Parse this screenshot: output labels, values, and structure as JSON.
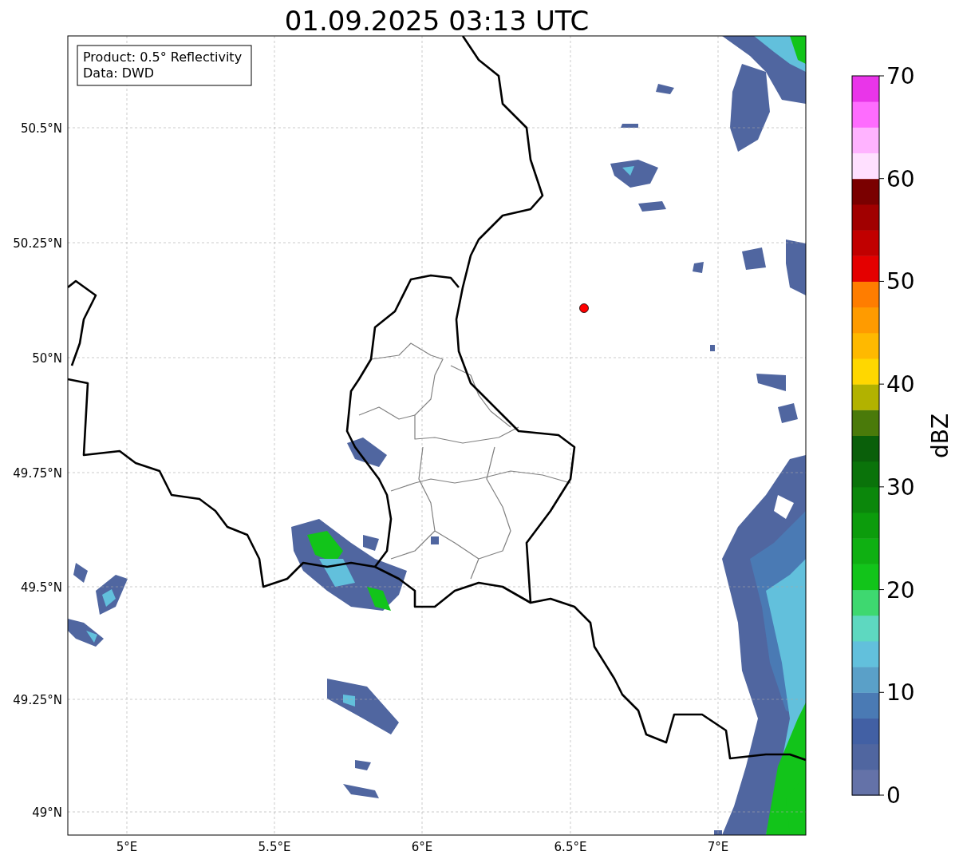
{
  "title": "01.09.2025 03:13 UTC",
  "legend": [
    "Product: 0.5° Reflectivity",
    "Data: DWD"
  ],
  "x_ticks": [
    "5°E",
    "5.5°E",
    "6°E",
    "6.5°E",
    "7°E"
  ],
  "y_ticks": [
    "50.5°N",
    "50.25°N",
    "50°N",
    "49.75°N",
    "49.5°N",
    "49.25°N",
    "49°N"
  ],
  "colorbar": {
    "label": "dBZ",
    "ticks": [
      "70",
      "60",
      "50",
      "40",
      "30",
      "20",
      "10",
      "0"
    ],
    "segments": [
      {
        "color": "#6472a8"
      },
      {
        "color": "#5066a0"
      },
      {
        "color": "#4260a4"
      },
      {
        "color": "#4a7ab4"
      },
      {
        "color": "#5aa0c8"
      },
      {
        "color": "#62c0dc"
      },
      {
        "color": "#5ed8c0"
      },
      {
        "color": "#3ed870"
      },
      {
        "color": "#12c41a"
      },
      {
        "color": "#0fb012"
      },
      {
        "color": "#0c9c0c"
      },
      {
        "color": "#0b870b"
      },
      {
        "color": "#0a730a"
      },
      {
        "color": "#0a5f0a"
      },
      {
        "color": "#4a7a0a"
      },
      {
        "color": "#b2b200"
      },
      {
        "color": "#ffd700"
      },
      {
        "color": "#ffb900"
      },
      {
        "color": "#ff9b00"
      },
      {
        "color": "#ff7d00"
      },
      {
        "color": "#e40000"
      },
      {
        "color": "#c10000"
      },
      {
        "color": "#a10000"
      },
      {
        "color": "#7a0000"
      },
      {
        "color": "#ffe0ff"
      },
      {
        "color": "#ffb3ff"
      },
      {
        "color": "#fe6cfe"
      },
      {
        "color": "#e935e9"
      }
    ]
  }
}
